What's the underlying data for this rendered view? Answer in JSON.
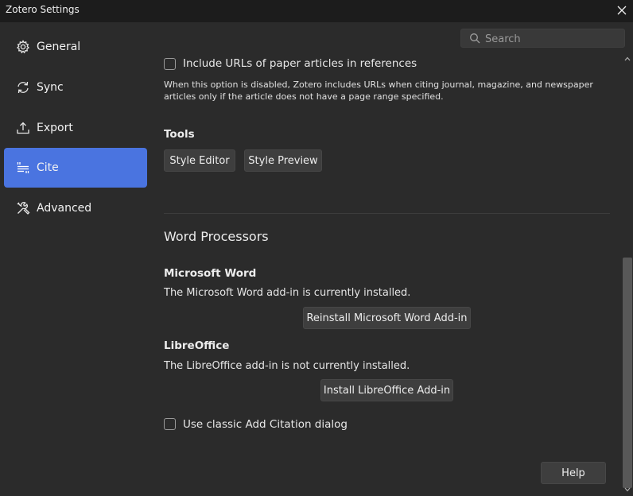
{
  "window": {
    "title": "Zotero Settings"
  },
  "sidebar": {
    "items": [
      {
        "label": "General",
        "icon": "gear-icon"
      },
      {
        "label": "Sync",
        "icon": "sync-icon"
      },
      {
        "label": "Export",
        "icon": "export-icon"
      },
      {
        "label": "Cite",
        "icon": "cite-icon",
        "active": true
      },
      {
        "label": "Advanced",
        "icon": "wrench-icon"
      }
    ]
  },
  "search": {
    "placeholder": "Search",
    "value": ""
  },
  "cite": {
    "include_urls": {
      "label": "Include URLs of paper articles in references",
      "checked": false,
      "hint": "When this option is disabled, Zotero includes URLs when citing journal, magazine, and newspaper articles only if the article does not have a page range specified."
    },
    "tools": {
      "heading": "Tools",
      "style_editor": "Style Editor",
      "style_preview": "Style Preview"
    },
    "word_processors": {
      "heading": "Word Processors",
      "msword": {
        "heading": "Microsoft Word",
        "status": "The Microsoft Word add-in is currently installed.",
        "button": "Reinstall Microsoft Word Add-in"
      },
      "libreoffice": {
        "heading": "LibreOffice",
        "status": "The LibreOffice add-in is not currently installed.",
        "button": "Install LibreOffice Add-in"
      },
      "classic_dialog": {
        "label": "Use classic Add Citation dialog",
        "checked": false
      }
    }
  },
  "footer": {
    "help": "Help"
  },
  "colors": {
    "accent": "#4a74e0",
    "background": "#2b2b2b",
    "titlebar": "#1c1c1c"
  }
}
